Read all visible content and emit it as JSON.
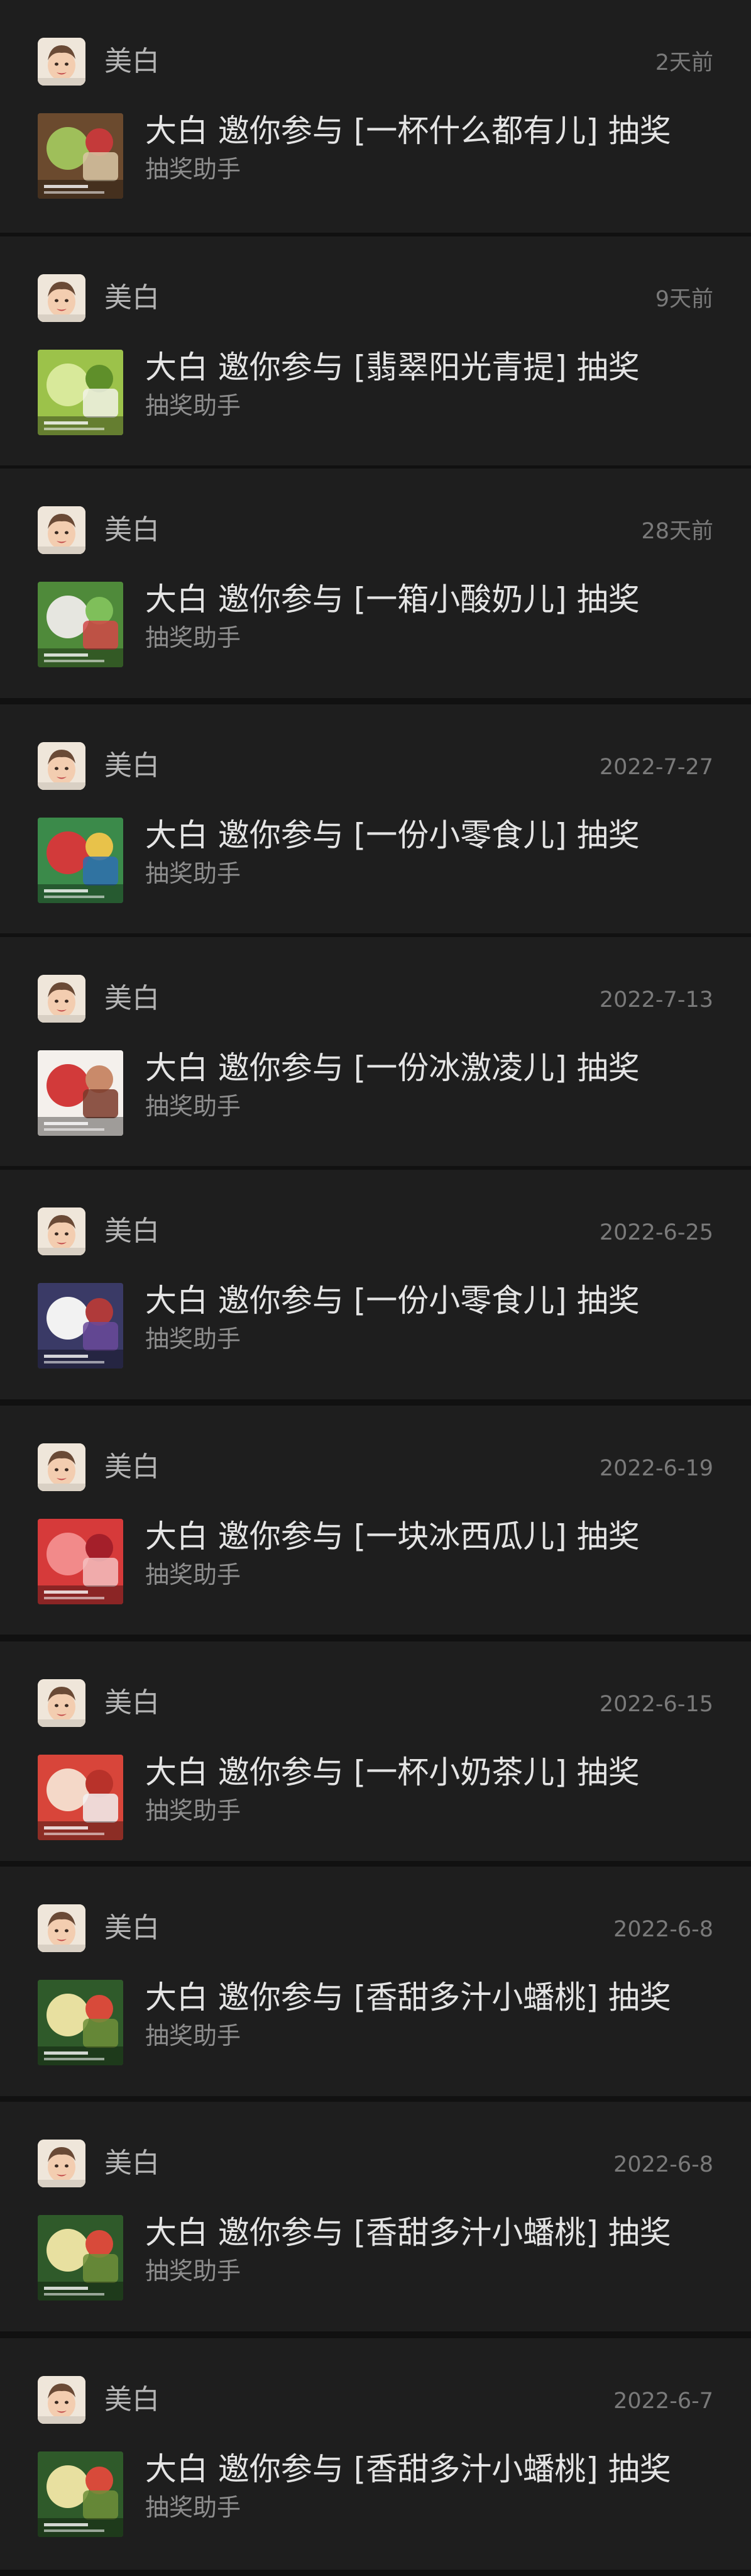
{
  "messages": [
    {
      "sender": "美白",
      "time": "2天前",
      "title": "大白 邀你参与 [一杯什么都有儿] 抽奖",
      "subtitle": "抽奖助手",
      "thumb_colors": [
        "#6b4a2e",
        "#9fbf5a",
        "#c43a3a",
        "#d9c7a4"
      ],
      "thumb_name": "drink-cup-thumbnail"
    },
    {
      "sender": "美白",
      "time": "9天前",
      "title": "大白 邀你参与 [翡翠阳光青提] 抽奖",
      "subtitle": "抽奖助手",
      "thumb_colors": [
        "#9cc24a",
        "#d8e99a",
        "#5f8f2a",
        "#f2f2e6"
      ],
      "thumb_name": "green-grapes-thumbnail"
    },
    {
      "sender": "美白",
      "time": "28天前",
      "title": "大白 邀你参与 [一箱小酸奶儿] 抽奖",
      "subtitle": "抽奖助手",
      "thumb_colors": [
        "#4f8a3a",
        "#e6e6e0",
        "#7fbf5a",
        "#d14848"
      ],
      "thumb_name": "yogurt-box-thumbnail"
    },
    {
      "sender": "美白",
      "time": "2022-7-27",
      "title": "大白 邀你参与 [一份小零食儿] 抽奖",
      "subtitle": "抽奖助手",
      "thumb_colors": [
        "#3b8a4a",
        "#d23a3a",
        "#e8c24a",
        "#2f6fb0"
      ],
      "thumb_name": "snacks-thumbnail"
    },
    {
      "sender": "美白",
      "time": "2022-7-13",
      "title": "大白 邀你参与 [一份冰激凌儿] 抽奖",
      "subtitle": "抽奖助手",
      "thumb_colors": [
        "#f4f0ec",
        "#d23a3a",
        "#c98a6a",
        "#7a3a2a"
      ],
      "thumb_name": "ice-cream-thumbnail"
    },
    {
      "sender": "美白",
      "time": "2022-6-25",
      "title": "大白 邀你参与 [一份小零食儿] 抽奖",
      "subtitle": "抽奖助手",
      "thumb_colors": [
        "#3a3a66",
        "#f2f2f2",
        "#b03a3a",
        "#6a4a9a"
      ],
      "thumb_name": "snacks-character-thumbnail"
    },
    {
      "sender": "美白",
      "time": "2022-6-19",
      "title": "大白 邀你参与 [一块冰西瓜儿] 抽奖",
      "subtitle": "抽奖助手",
      "thumb_colors": [
        "#d63a3a",
        "#f28a8a",
        "#a41f2a",
        "#f4c0c0"
      ],
      "thumb_name": "watermelon-thumbnail"
    },
    {
      "sender": "美白",
      "time": "2022-6-15",
      "title": "大白 邀你参与 [一杯小奶茶儿] 抽奖",
      "subtitle": "抽奖助手",
      "thumb_colors": [
        "#d8453a",
        "#f4d8c8",
        "#b8322a",
        "#f2f2f2"
      ],
      "thumb_name": "milk-tea-thumbnail"
    },
    {
      "sender": "美白",
      "time": "2022-6-8",
      "title": "大白 邀你参与 [香甜多汁小蟠桃] 抽奖",
      "subtitle": "抽奖助手",
      "thumb_colors": [
        "#2f5a2a",
        "#e8e0a0",
        "#d84a3a",
        "#6f8f3a"
      ],
      "thumb_name": "flat-peach-thumbnail"
    },
    {
      "sender": "美白",
      "time": "2022-6-8",
      "title": "大白 邀你参与 [香甜多汁小蟠桃] 抽奖",
      "subtitle": "抽奖助手",
      "thumb_colors": [
        "#2f5a2a",
        "#e8e0a0",
        "#d84a3a",
        "#6f8f3a"
      ],
      "thumb_name": "flat-peach-thumbnail"
    },
    {
      "sender": "美白",
      "time": "2022-6-7",
      "title": "大白 邀你参与 [香甜多汁小蟠桃] 抽奖",
      "subtitle": "抽奖助手",
      "thumb_colors": [
        "#2f5a2a",
        "#e8e0a0",
        "#d84a3a",
        "#6f8f3a"
      ],
      "thumb_name": "flat-peach-thumbnail"
    }
  ],
  "colors": {
    "background": "#111111",
    "card": "#1e1e1e",
    "title_text": "#e4e4e4",
    "muted_text": "#8e8e8e"
  },
  "icons": {
    "avatar": "baby-avatar-icon"
  }
}
